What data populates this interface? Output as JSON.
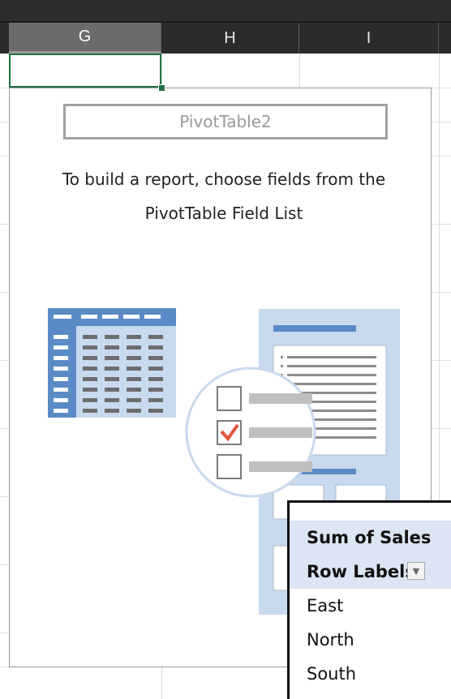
{
  "spreadsheet": {
    "columns": [
      "G",
      "H",
      "I"
    ],
    "selected_column": "G"
  },
  "pivot_placeholder": {
    "name": "PivotTable2",
    "instructions_line1": "To build a report, choose fields from the",
    "instructions_line2": "PivotTable Field List"
  },
  "illustration": {
    "icons": [
      "table-grid-icon",
      "field-list-panel-icon",
      "checklist-circle-icon"
    ],
    "colors": {
      "blue_dark": "#5b8bc6",
      "blue_light": "#c9d9ee",
      "gray": "#bfbfbf",
      "check_red": "#e0563a"
    }
  },
  "pivot_table": {
    "value_field": "Sum of Sales",
    "row_labels_header": "Row Labels",
    "filter_icon": "dropdown-arrow-icon",
    "rows": [
      "East",
      "North",
      "South"
    ],
    "header_color": "#dbe5f4"
  }
}
